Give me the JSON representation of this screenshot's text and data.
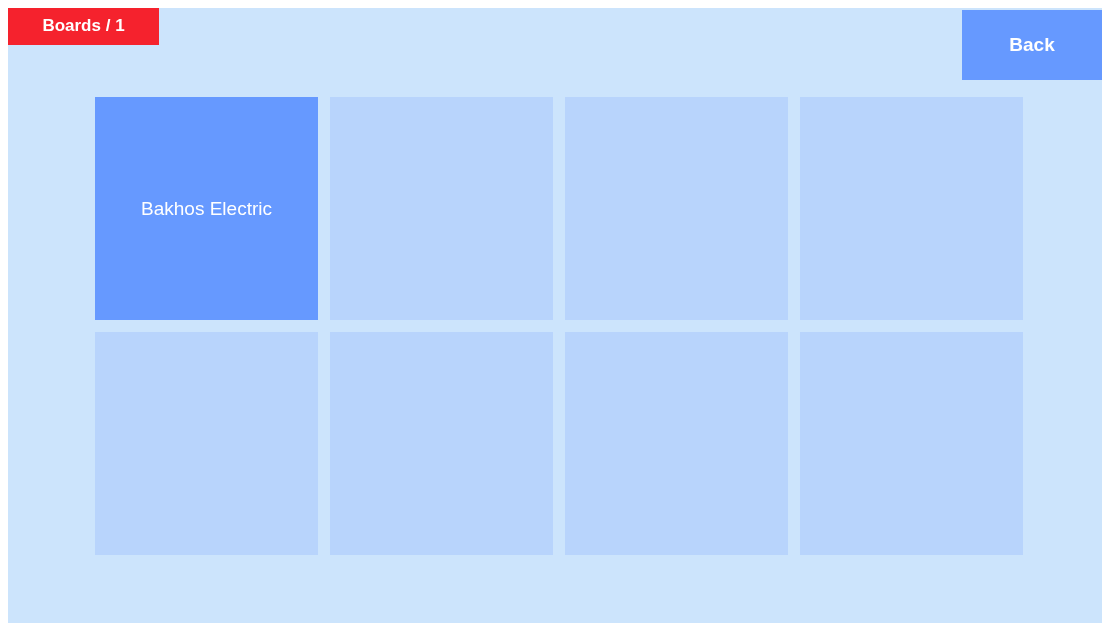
{
  "breadcrumb": "Boards / 1",
  "back_button": "Back",
  "tiles": [
    {
      "kind": "board",
      "label": "Bakhos Electric"
    },
    {
      "kind": "empty"
    },
    {
      "kind": "empty"
    },
    {
      "kind": "empty"
    },
    {
      "kind": "empty"
    },
    {
      "kind": "empty"
    },
    {
      "kind": "empty"
    },
    {
      "kind": "empty"
    }
  ]
}
